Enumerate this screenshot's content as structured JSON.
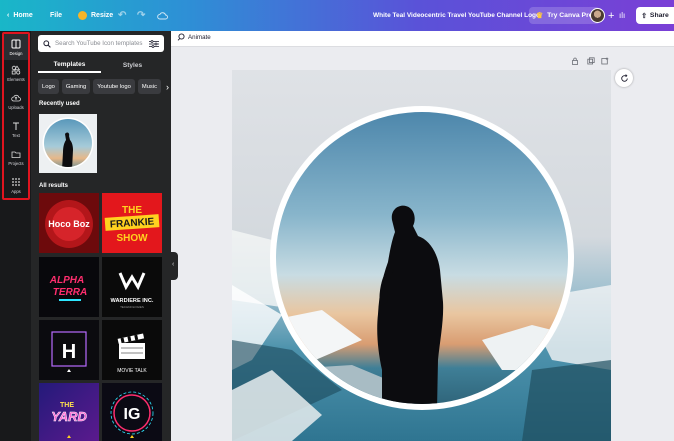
{
  "topbar": {
    "home_label": "Home",
    "file_label": "File",
    "resize_label": "Resize",
    "doc_title": "White Teal Videocentric Travel YouTube Channel Logo",
    "pro_label": "Try Canva Pro",
    "share_label": "Share"
  },
  "rail": {
    "items": [
      {
        "label": "Design",
        "icon": "design-icon"
      },
      {
        "label": "Elements",
        "icon": "elements-icon"
      },
      {
        "label": "Uploads",
        "icon": "upload-cloud-icon"
      },
      {
        "label": "Text",
        "icon": "text-icon"
      },
      {
        "label": "Projects",
        "icon": "folder-icon"
      },
      {
        "label": "Apps",
        "icon": "apps-grid-icon"
      }
    ]
  },
  "panel": {
    "search_placeholder": "Search YouTube Icon templates",
    "tabs": [
      "Templates",
      "Styles"
    ],
    "chips": [
      "Logo",
      "Gaming",
      "Youtube logo",
      "Music"
    ],
    "recent_heading": "Recently used",
    "all_heading": "All results",
    "templates": [
      {
        "text": "Hoco Boz"
      },
      {
        "text_lines": [
          "THE",
          "FRANKIE",
          "SHOW"
        ]
      },
      {
        "text_lines": [
          "ALPHA",
          "TERRA"
        ]
      },
      {
        "text": "WARDIERE INC.",
        "sub": "TECHNOLOGIES"
      },
      {
        "text": "H"
      },
      {
        "text": "MOVIE TALK"
      },
      {
        "text_lines": [
          "THE",
          "YARD"
        ]
      },
      {
        "text": "IG"
      }
    ]
  },
  "canvas": {
    "animate_label": "Animate"
  },
  "colors": {
    "accent_red": "#e0141f",
    "panel_bg": "#252627",
    "rail_bg": "#18191b"
  }
}
